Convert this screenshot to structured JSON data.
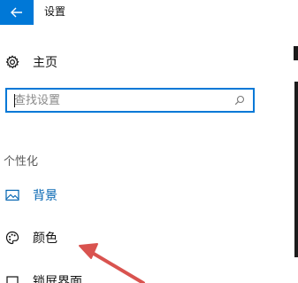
{
  "window": {
    "title": "设置",
    "accent_color": "#0078d7"
  },
  "nav": {
    "back_icon": "back-arrow-icon",
    "home": {
      "label": "主页",
      "icon": "gear-icon"
    },
    "search": {
      "placeholder": "查找设置",
      "value": "",
      "icon": "search-icon"
    },
    "section_title": "个性化",
    "items": [
      {
        "label": "背景",
        "icon": "picture-icon",
        "active": true
      },
      {
        "label": "颜色",
        "icon": "palette-icon",
        "active": false
      },
      {
        "label": "锁屏界面",
        "icon": "lock-screen-icon",
        "active": false
      }
    ]
  },
  "annotation": {
    "type": "arrow",
    "color": "#d9534f",
    "points_to": "颜色"
  }
}
